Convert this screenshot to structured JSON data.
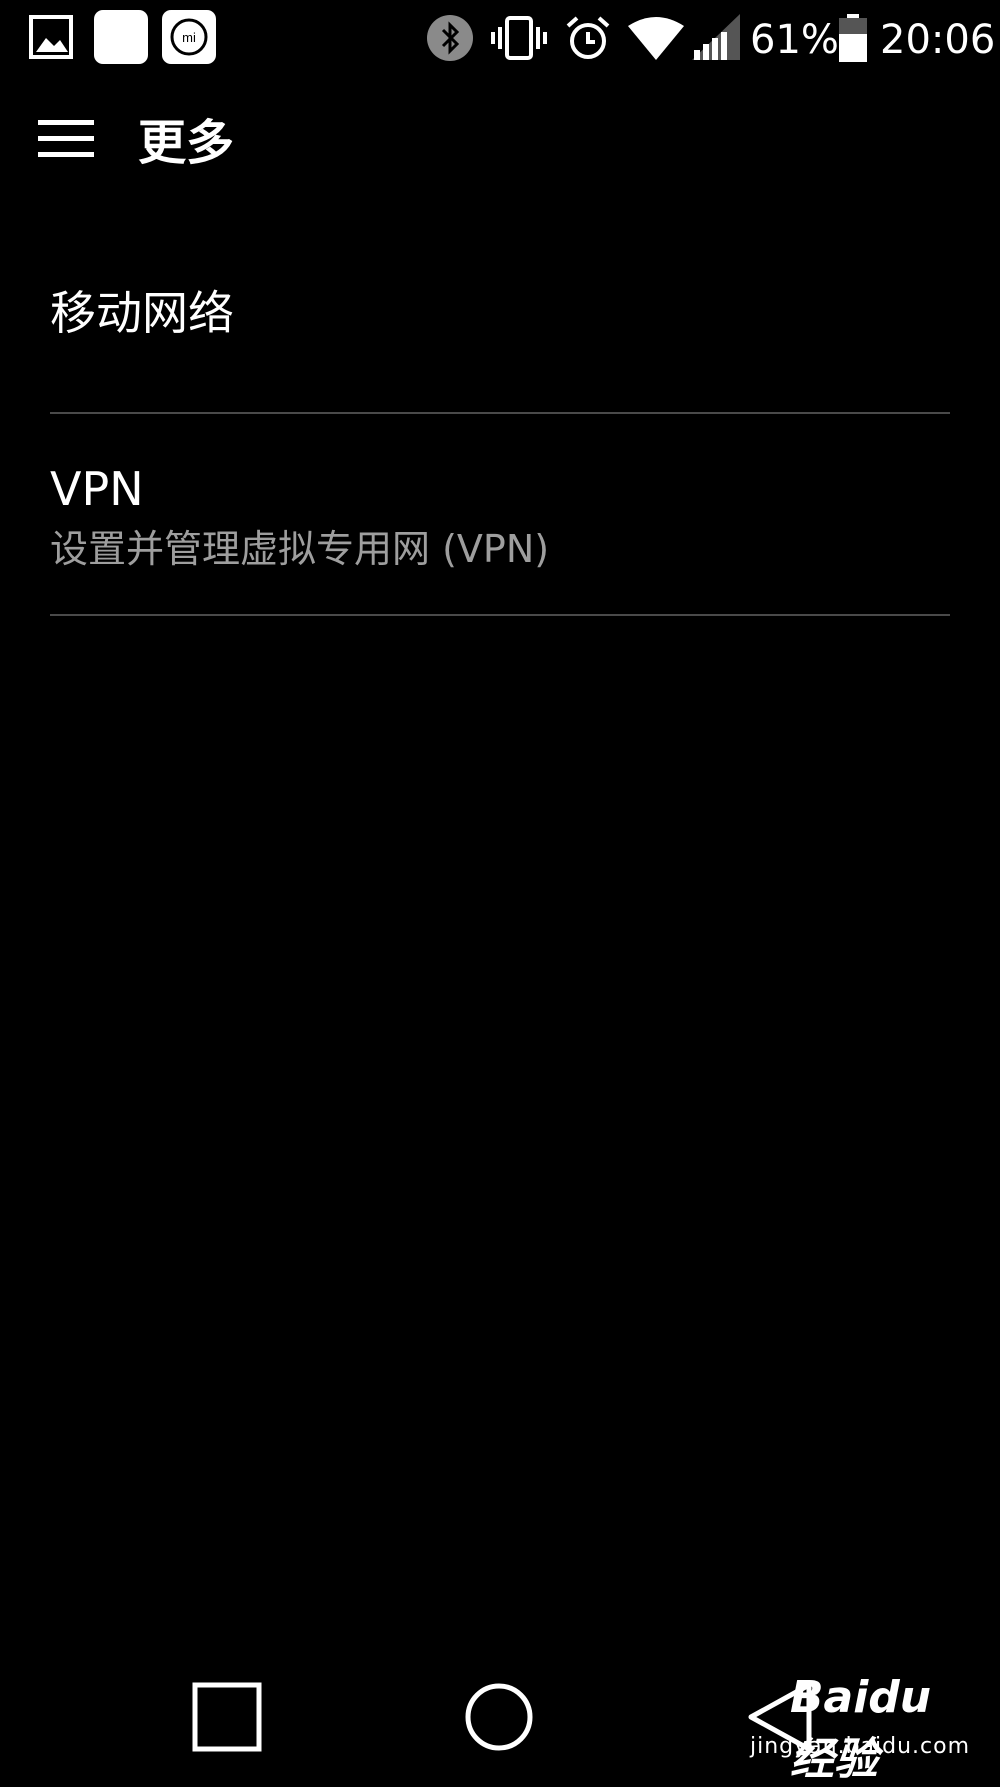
{
  "status_bar": {
    "left_icons": [
      "gallery-icon",
      "notification-blank-icon",
      "mi-icon"
    ],
    "right_icons": [
      "bluetooth-icon",
      "vibrate-icon",
      "alarm-icon",
      "wifi-icon",
      "signal-icon",
      "battery-icon"
    ],
    "battery": "61%",
    "time": "20:06"
  },
  "toolbar": {
    "title": "更多",
    "menu_icon": "hamburger-menu-icon"
  },
  "list": {
    "items": [
      {
        "title": "移动网络"
      },
      {
        "title": "VPN",
        "subtitle": "设置并管理虚拟专用网 (VPN)"
      }
    ]
  },
  "nav_bar": {
    "buttons": [
      "recent-apps-icon",
      "home-icon",
      "back-icon"
    ]
  },
  "watermark": {
    "brand": "Baidu经验",
    "url": "jingyan.baidu.com"
  },
  "colors": {
    "background": "#000000",
    "text": "#ffffff",
    "subtext": "#9e9e9e",
    "divider": "#4a4a4a"
  }
}
